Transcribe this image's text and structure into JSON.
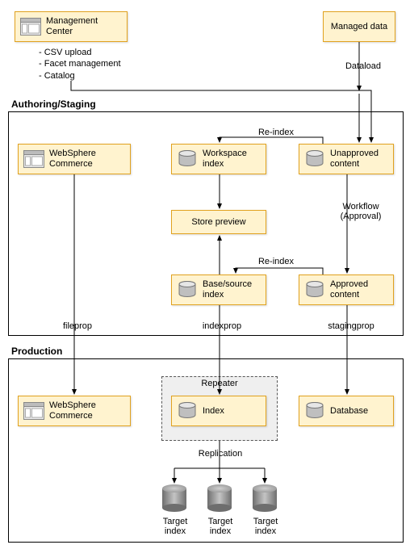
{
  "top": {
    "management_center": "Management Center",
    "managed_data": "Managed data",
    "bullets": [
      "CSV upload",
      "Facet management",
      "Catalog"
    ],
    "dataload_label": "Dataload"
  },
  "authoring": {
    "title": "Authoring/Staging",
    "websphere": "WebSphere Commerce",
    "workspace_index": "Workspace index",
    "unapproved_content": "Unapproved content",
    "store_preview": "Store preview",
    "base_source_index": "Base/source index",
    "approved_content": "Approved content",
    "reindex_label": "Re-index",
    "reindex_label2": "Re-index",
    "workflow_label": "Workflow (Approval)",
    "fileprop_label": "fileprop",
    "indexprop_label": "indexprop",
    "stagingprop_label": "stagingprop"
  },
  "production": {
    "title": "Production",
    "websphere": "WebSphere Commerce",
    "repeater_title": "Repeater",
    "index": "Index",
    "database": "Database",
    "replication_label": "Replication",
    "target1": "Target index",
    "target2": "Target index",
    "target3": "Target index"
  }
}
